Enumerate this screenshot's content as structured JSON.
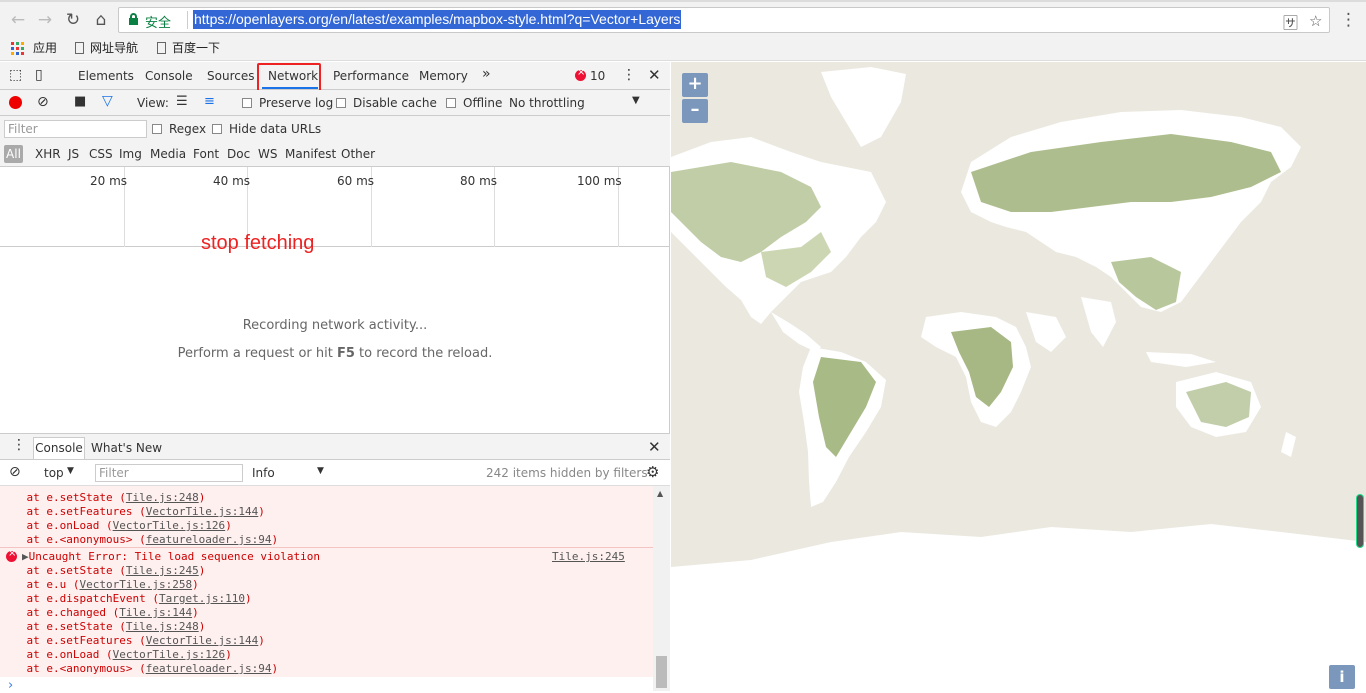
{
  "browser": {
    "secure_label": "安全",
    "url": "https://openlayers.org/en/latest/examples/mapbox-style.html?q=Vector+Layers",
    "bookmarks": [
      "应用",
      "网址导航",
      "百度一下"
    ]
  },
  "devtools": {
    "tabs": [
      "Elements",
      "Console",
      "Sources",
      "Network",
      "Performance",
      "Memory"
    ],
    "more_tabs": "»",
    "error_count": "10",
    "toolbar": {
      "view_label": "View:",
      "preserve_log": "Preserve log",
      "disable_cache": "Disable cache",
      "offline": "Offline",
      "throttling": "No throttling"
    },
    "filter": {
      "placeholder": "Filter",
      "regex": "Regex",
      "hide_data_urls": "Hide data URLs"
    },
    "types": [
      "All",
      "XHR",
      "JS",
      "CSS",
      "Img",
      "Media",
      "Font",
      "Doc",
      "WS",
      "Manifest",
      "Other"
    ],
    "timeline_ticks": [
      "20 ms",
      "40 ms",
      "60 ms",
      "80 ms",
      "100 ms"
    ],
    "annotation": "stop fetching",
    "empty_title": "Recording network activity...",
    "empty_hint_pre": "Perform a request or hit ",
    "empty_hint_key": "F5",
    "empty_hint_post": " to record the reload.",
    "drawer": {
      "tabs": [
        "Console",
        "What's New"
      ],
      "context": "top",
      "filter_placeholder": "Filter",
      "level": "Info",
      "hidden_count": "242 items hidden by filters"
    },
    "console_lines": [
      {
        "text": "    at e.setState (",
        "link": "Tile.js:248",
        "tail": ")"
      },
      {
        "text": "    at e.setFeatures (",
        "link": "VectorTile.js:144",
        "tail": ")"
      },
      {
        "text": "    at e.onLoad (",
        "link": "VectorTile.js:126",
        "tail": ")"
      },
      {
        "text": "    at e.<anonymous> (",
        "link": "featureloader.js:94",
        "tail": ")"
      }
    ],
    "error_message": "Uncaught Error: Tile load sequence violation",
    "error_source": "Tile.js:245",
    "error_lines": [
      {
        "text": "    at e.setState (",
        "link": "Tile.js:245",
        "tail": ")"
      },
      {
        "text": "    at e.u (",
        "link": "VectorTile.js:258",
        "tail": ")"
      },
      {
        "text": "    at e.dispatchEvent (",
        "link": "Target.js:110",
        "tail": ")"
      },
      {
        "text": "    at e.changed (",
        "link": "Tile.js:144",
        "tail": ")"
      },
      {
        "text": "    at e.setState (",
        "link": "Tile.js:248",
        "tail": ")"
      },
      {
        "text": "    at e.setFeatures (",
        "link": "VectorTile.js:144",
        "tail": ")"
      },
      {
        "text": "    at e.onLoad (",
        "link": "VectorTile.js:126",
        "tail": ")"
      },
      {
        "text": "    at e.<anonymous> (",
        "link": "featureloader.js:94",
        "tail": ")"
      }
    ]
  },
  "map": {
    "zoom_in": "+",
    "zoom_out": "–",
    "info": "i",
    "land_color": "#b5c497",
    "water_color": "#ffffff",
    "bg_color": "#ebe8df"
  }
}
